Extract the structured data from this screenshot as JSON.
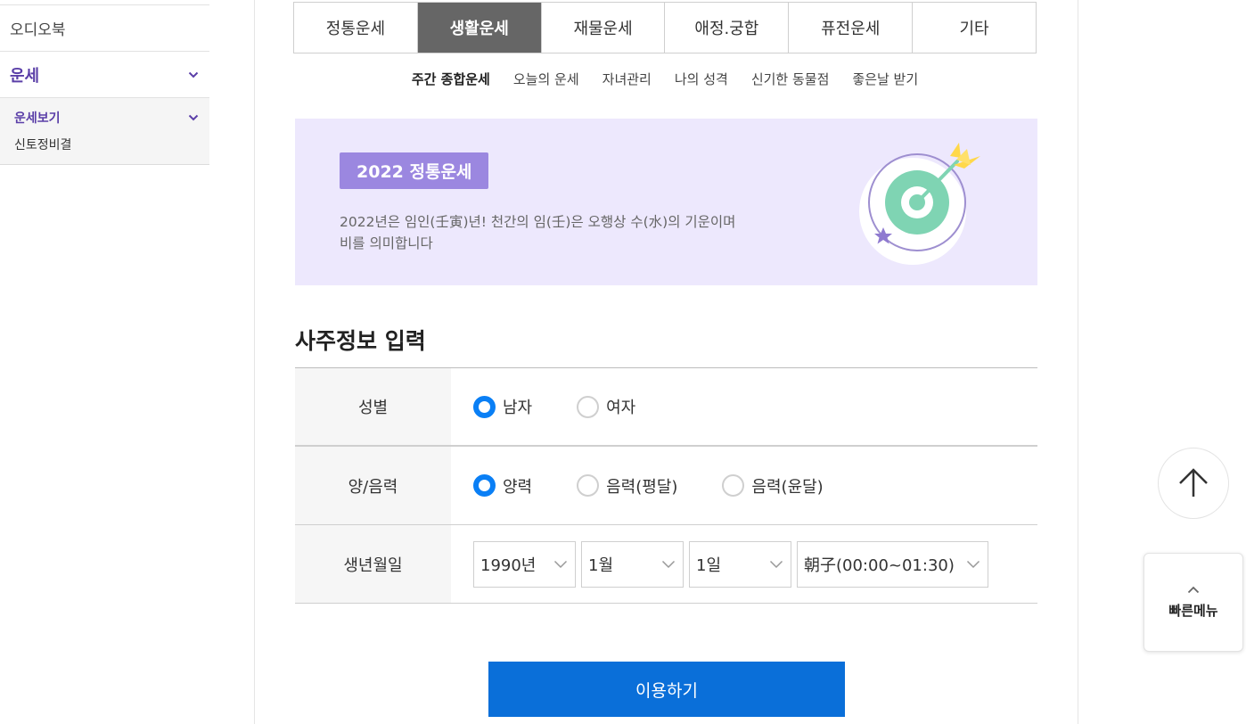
{
  "sidebar": {
    "item_audiobook": "오디오북",
    "section_fortune": "운세",
    "sub_group": "운세보기",
    "sub_item": "신토정비결"
  },
  "tabs": [
    {
      "label": "정통운세",
      "active": false
    },
    {
      "label": "생활운세",
      "active": true
    },
    {
      "label": "재물운세",
      "active": false
    },
    {
      "label": "애정.궁합",
      "active": false
    },
    {
      "label": "퓨전운세",
      "active": false
    },
    {
      "label": "기타",
      "active": false
    }
  ],
  "subtabs": [
    {
      "label": "주간 종합운세",
      "active": true
    },
    {
      "label": "오늘의 운세",
      "active": false
    },
    {
      "label": "자녀관리",
      "active": false
    },
    {
      "label": "나의 성격",
      "active": false
    },
    {
      "label": "신기한 동물점",
      "active": false
    },
    {
      "label": "좋은날 받기",
      "active": false
    }
  ],
  "banner": {
    "badge": "2022 정통운세",
    "desc_line1": "2022년은 임인(壬寅)년! 천간의 임(壬)은 오행상 수(水)의 기운이며",
    "desc_line2": "비를 의미합니다",
    "icon": "target-arrow-icon",
    "bg_color": "#ede8fd",
    "badge_color": "#9b87e0"
  },
  "form": {
    "title": "사주정보 입력",
    "gender": {
      "label": "성별",
      "options": [
        {
          "label": "남자",
          "checked": true
        },
        {
          "label": "여자",
          "checked": false
        }
      ]
    },
    "calendar": {
      "label": "양/음력",
      "options": [
        {
          "label": "양력",
          "checked": true
        },
        {
          "label": "음력(평달)",
          "checked": false
        },
        {
          "label": "음력(윤달)",
          "checked": false
        }
      ]
    },
    "birth": {
      "label": "생년월일",
      "year": "1990년",
      "month": "1월",
      "day": "1일",
      "hour": "朝子(00:00~01:30)"
    },
    "submit_label": "이용하기",
    "accent_color": "#0a7ff5",
    "submit_color": "#0a6fd9"
  },
  "floating": {
    "top_icon": "arrow-up-icon",
    "quick_menu_label": "빠른메뉴",
    "quick_menu_icon": "chevron-up-icon"
  }
}
